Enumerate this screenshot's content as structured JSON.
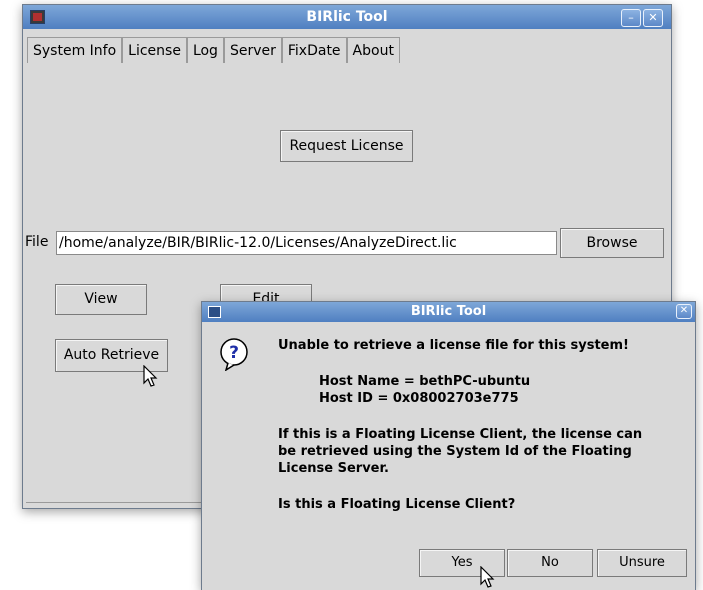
{
  "main_window": {
    "title": "BIRlic Tool",
    "tabs": [
      "System Info",
      "License",
      "Log",
      "Server",
      "FixDate",
      "About"
    ],
    "active_tab": "License",
    "request_license_label": "Request License",
    "file_label": "File",
    "file_path": "/home/analyze/BIR/BIRlic-12.0/Licenses/AnalyzeDirect.lic",
    "browse_label": "Browse",
    "view_label": "View",
    "edit_label": "Edit",
    "auto_retrieve_label": "Auto Retrieve"
  },
  "dialog": {
    "title": "BIRlic Tool",
    "icon": "question-icon",
    "line1": "Unable to retrieve a license file for this system!",
    "host_name": "Host Name = bethPC-ubuntu",
    "host_id": "Host ID = 0x08002703e775",
    "info1": "If this is a Floating License Client, the license can",
    "info2": "be retrieved using the System Id of the Floating",
    "info3": "License Server.",
    "question": "Is this a Floating License Client?",
    "buttons": {
      "yes": "Yes",
      "no": "No",
      "unsure": "Unsure"
    }
  },
  "colors": {
    "titlebar": "#5f8fcf",
    "window_bg": "#d9d9d9"
  }
}
